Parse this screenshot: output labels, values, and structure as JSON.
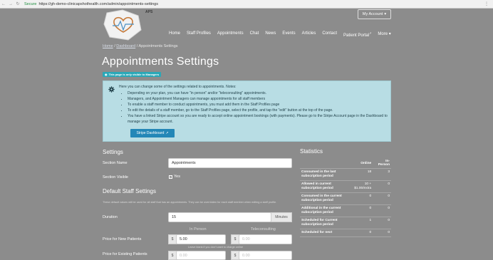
{
  "browser": {
    "secure_label": "Secure",
    "url": "https://gh-demo-clinicapshothealth.com/admin/appointments-settings"
  },
  "header": {
    "org_short": "APS",
    "account_button": "My Account",
    "nav": [
      {
        "label": "Home"
      },
      {
        "label": "Staff Profiles"
      },
      {
        "label": "Appointments"
      },
      {
        "label": "Chat"
      },
      {
        "label": "News"
      },
      {
        "label": "Events"
      },
      {
        "label": "Articles"
      },
      {
        "label": "Contact"
      },
      {
        "label": "Patient Portal"
      },
      {
        "label": "More"
      }
    ]
  },
  "breadcrumb": {
    "home": "Home",
    "dashboard": "Dashboard",
    "current": "Appointments Settings"
  },
  "page": {
    "title": "Appointments Settings",
    "managers_badge": "This page is only visible to Managers"
  },
  "info": {
    "intro": "Here you can change some of the settings related to appointments. Notes:",
    "bullets": [
      "Depending on your plan, you can have \"in person\" and/or \"teleconsulting\" appointments.",
      "Managers, and Appointment Managers can manage appointments for all staff members",
      "To enable a staff member to conduct appointments, you must add them in the Staff Profiles page",
      "To edit the details of a staff member, go to the Staff Profiles page, select the profile, and tap the \"edit\" button at the top of the page.",
      "You have a linked Stripe account so you are ready to accept online appointment bookings (with payments). Please go to the Stripe Account page in the Dashboard to manage your Stripe account."
    ],
    "stripe_button": "Stripe Dashboard"
  },
  "settings": {
    "heading": "Settings",
    "section_name_label": "Section Name",
    "section_name_value": "Appointments",
    "section_visible_label": "Section Visible",
    "section_visible_value": "Yes"
  },
  "staff_settings": {
    "heading": "Default Staff Settings",
    "help": "These default values will be used for all staff that has an appointments. They can be overridden for each staff member when editing a staff profile.",
    "duration_label": "Duration",
    "duration_value": "15",
    "duration_unit": "Minutes",
    "in_person_header": "In Person",
    "teleconsulting_header": "Teleconsulting",
    "price_new_label": "Price for New Patients",
    "currency": "$",
    "price_new_in_person": "5.00",
    "price_new_tele_placeholder": "0.00",
    "price_hint": "Leave blank if you don't want to charge online",
    "price_existing_label": "Price for Existing Patients",
    "price_existing_in_person_placeholder": "0.00",
    "price_existing_tele_placeholder": "0.00"
  },
  "statistics": {
    "title": "Statistics",
    "col_online": "Online",
    "col_in_person": "In-Person",
    "rows": [
      {
        "label": "Consumed in the last subscription period",
        "online": "18",
        "in_person": "3"
      },
      {
        "label": "Allowed in current subscription period",
        "online": "10 + $1.00/extra",
        "in_person": "0"
      },
      {
        "label": "Consumed in the current subscription period",
        "online": "0",
        "in_person": "0"
      },
      {
        "label": "Additional in the current subscription period",
        "online": "0",
        "in_person": "0"
      },
      {
        "label": "Scheduled for Current subscription period",
        "online": "1",
        "in_person": "0"
      },
      {
        "label": "Scheduled for next",
        "online": "0",
        "in_person": "0"
      }
    ]
  },
  "colors": {
    "page_bg": "#8c8c8c",
    "info_bg": "#b8dde4",
    "accent": "#2487b7",
    "badge": "#2aa8b8"
  }
}
